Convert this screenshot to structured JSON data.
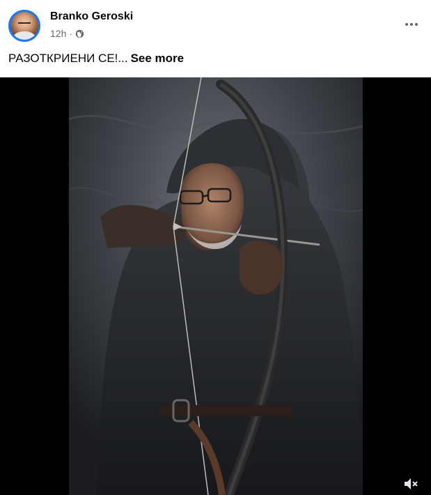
{
  "post": {
    "author": "Branko Geroski",
    "time": "12h",
    "separator": "·",
    "privacy_icon": "globe-icon",
    "text": "РАЗОТКРИЕНИ СЕ!...",
    "see_more": "See more",
    "more_icon": "more-horizontal-icon"
  },
  "media": {
    "type": "video",
    "sound_icon": "muted-speaker-icon"
  },
  "colors": {
    "author": "#050505",
    "meta": "#65676b",
    "avatar_ring": "#1877f2",
    "media_bg": "#000000"
  }
}
